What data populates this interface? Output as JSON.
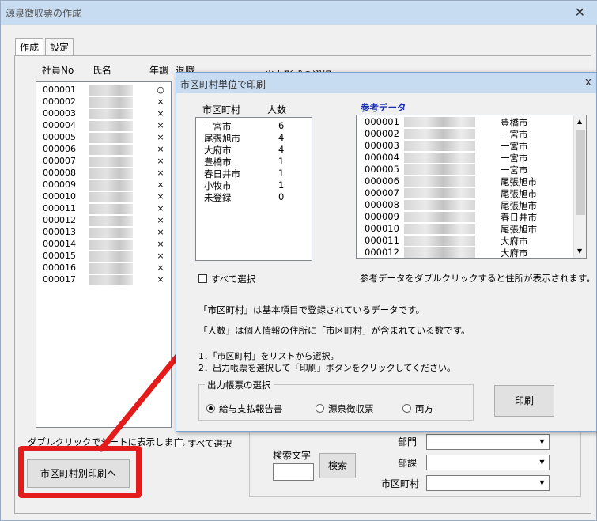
{
  "main_window": {
    "title": "源泉徴収票の作成",
    "close": "✕",
    "tabs": [
      "作成",
      "設定"
    ],
    "columns": {
      "emp_no": "社員No",
      "name": "氏名",
      "nencho": "年調",
      "retire": "退職",
      "output": "出力形式の選択"
    },
    "employees": [
      {
        "code": "000001",
        "mark": "○"
      },
      {
        "code": "000002",
        "mark": "×"
      },
      {
        "code": "000003",
        "mark": "×"
      },
      {
        "code": "000004",
        "mark": "×"
      },
      {
        "code": "000005",
        "mark": "×"
      },
      {
        "code": "000006",
        "mark": "×"
      },
      {
        "code": "000007",
        "mark": "×"
      },
      {
        "code": "000008",
        "mark": "×"
      },
      {
        "code": "000009",
        "mark": "×"
      },
      {
        "code": "000010",
        "mark": "×"
      },
      {
        "code": "000011",
        "mark": "×"
      },
      {
        "code": "000012",
        "mark": "×"
      },
      {
        "code": "000013",
        "mark": "×"
      },
      {
        "code": "000014",
        "mark": "×"
      },
      {
        "code": "000015",
        "mark": "×"
      },
      {
        "code": "000016",
        "mark": "×"
      },
      {
        "code": "000017",
        "mark": "×"
      }
    ],
    "dblclick_hint": "ダブルクリックでシートに表示します。",
    "select_all": "すべて選択",
    "city_print_button": "市区町村別印刷へ",
    "search_label": "検索文字",
    "search_button": "検索",
    "filters": {
      "dept": "部門",
      "section": "部課",
      "city": "市区町村"
    }
  },
  "dialog": {
    "title": "市区町村単位で印刷",
    "close": "x",
    "city_header": "市区町村",
    "count_header": "人数",
    "cities": [
      {
        "name": "一宮市",
        "count": "6"
      },
      {
        "name": "尾張旭市",
        "count": "4"
      },
      {
        "name": "大府市",
        "count": "4"
      },
      {
        "name": "豊橋市",
        "count": "1"
      },
      {
        "name": "春日井市",
        "count": "1"
      },
      {
        "name": "小牧市",
        "count": "1"
      },
      {
        "name": "未登録",
        "count": "0"
      }
    ],
    "select_all": "すべて選択",
    "ref_title": "参考データ",
    "ref_rows": [
      {
        "code": "000001",
        "city": "豊橋市"
      },
      {
        "code": "000002",
        "city": "一宮市"
      },
      {
        "code": "000003",
        "city": "一宮市"
      },
      {
        "code": "000004",
        "city": "一宮市"
      },
      {
        "code": "000005",
        "city": "一宮市"
      },
      {
        "code": "000006",
        "city": "尾張旭市"
      },
      {
        "code": "000007",
        "city": "尾張旭市"
      },
      {
        "code": "000008",
        "city": "尾張旭市"
      },
      {
        "code": "000009",
        "city": "春日井市"
      },
      {
        "code": "000010",
        "city": "尾張旭市"
      },
      {
        "code": "000011",
        "city": "大府市"
      },
      {
        "code": "000012",
        "city": "大府市"
      }
    ],
    "ref_hint": "参考データをダブルクリックすると住所が表示されます。",
    "note1": "「市区町村」は基本項目で登録されているデータです。",
    "note2": "「人数」は個人情報の住所に「市区町村」が含まれている数です。",
    "step1": "1．「市区町村」をリストから選択。",
    "step2": "2．出力帳票を選択して「印刷」ボタンをクリックしてください。",
    "output_group": "出力帳票の選択",
    "radio_options": [
      "給与支払報告書",
      "源泉徴収票",
      "両方"
    ],
    "selected_radio": "給与支払報告書",
    "print_button": "印刷",
    "scroll_up": "▲",
    "scroll_down": "▼"
  },
  "colors": {
    "title_bar": "#c7dbf1",
    "highlight": "#e31b1b",
    "ref_title": "#1a2fb0"
  }
}
